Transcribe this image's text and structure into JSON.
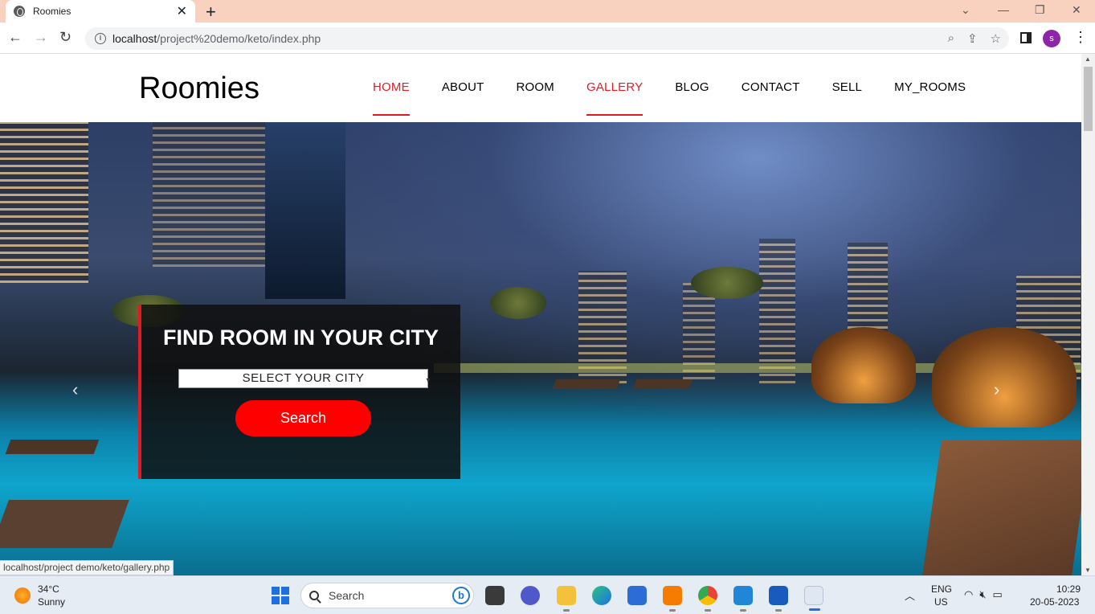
{
  "browser": {
    "tab_title": "Roomies",
    "new_tab": "+",
    "url_host": "localhost",
    "url_path": "/project%20demo/keto/index.php",
    "profile_initial": "s"
  },
  "site": {
    "brand": "Roomies",
    "nav": [
      {
        "label": "HOME",
        "active": true
      },
      {
        "label": "ABOUT",
        "active": false
      },
      {
        "label": "ROOM",
        "active": false
      },
      {
        "label": "GALLERY",
        "active": true
      },
      {
        "label": "BLOG",
        "active": false
      },
      {
        "label": "CONTACT",
        "active": false
      },
      {
        "label": "SELL",
        "active": false
      },
      {
        "label": "MY_ROOMS",
        "active": false
      }
    ],
    "hero": {
      "title": "FIND ROOM IN YOUR CITY",
      "select_value": "SELECT YOUR CITY",
      "search_button": "Search"
    },
    "status_url": "localhost/project demo/keto/gallery.php"
  },
  "taskbar": {
    "temperature": "34°C",
    "weather": "Sunny",
    "search_placeholder": "Search",
    "lang_top": "ENG",
    "lang_bottom": "US",
    "time": "10:29",
    "date": "20-05-2023"
  },
  "colors": {
    "accent": "#e01b24",
    "search_button": "#ff0000",
    "tab_strip": "#f8d2bf"
  }
}
